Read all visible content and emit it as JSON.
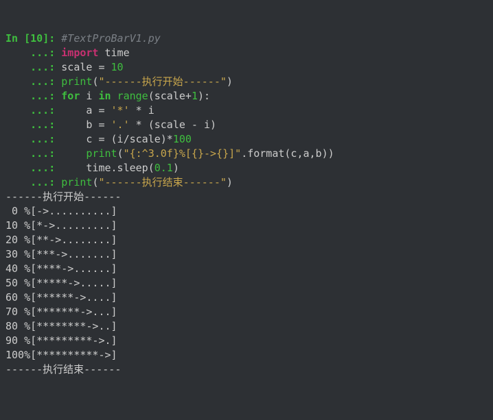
{
  "cell": {
    "in_label": "In [",
    "in_num": "10",
    "in_close": "]: ",
    "cont": "    ...: "
  },
  "code": {
    "l1_comment": "#TextProBarV1.py",
    "l2_import": "import",
    "l2_time": "time",
    "l3_scale": "scale",
    "l3_eq": " = ",
    "l3_10": "10",
    "l4_print": "print",
    "l4_str": "\"------执行开始------\"",
    "l5_for": "for",
    "l5_i": " i ",
    "l5_in": "in",
    "l5_range": "range",
    "l5_scale": "scale",
    "l5_plus1": "+",
    "l5_1": "1",
    "l6_a": "    a = ",
    "l6_star": "'*'",
    "l6_mul": " * i",
    "l7_b": "    b = ",
    "l7_dot": "'.'",
    "l7_expr": " * (scale - i)",
    "l8_c": "    c = (i/scale)*",
    "l8_100": "100",
    "l9_print": "print",
    "l9_str": "\"{:^3.0f}%[{}->{}]\"",
    "l9_format": ".format(c,a,b))",
    "l10_sleep": "    time.sleep(",
    "l10_val": "0.1",
    "l11_print": "print",
    "l11_str": "\"------执行结束------\""
  },
  "output_lines": [
    "------执行开始------",
    " 0 %[->..........]",
    "10 %[*->.........]",
    "20 %[**->........]",
    "30 %[***->.......]",
    "40 %[****->......]",
    "50 %[*****->.....]",
    "60 %[******->....]",
    "70 %[*******->...]",
    "80 %[********->..]",
    "90 %[*********->.]",
    "100%[**********->]",
    "------执行结束------"
  ]
}
